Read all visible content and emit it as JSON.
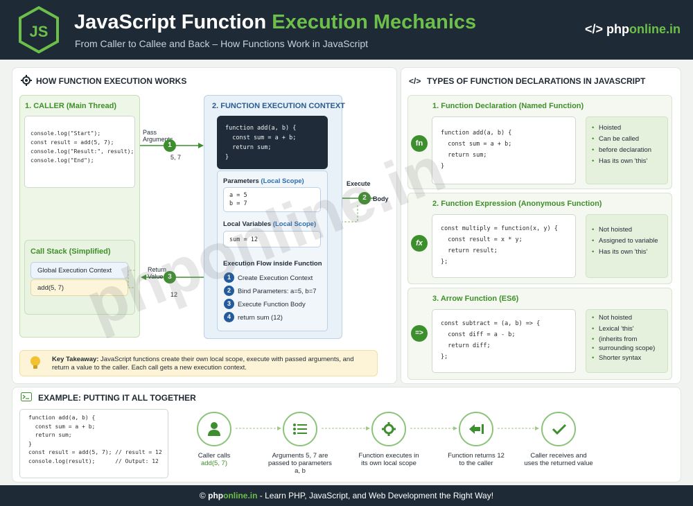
{
  "header": {
    "logo_text": "JS",
    "title_part1": "JavaScript Function ",
    "title_part2": "Execution Mechanics",
    "subtitle": "From Caller to Callee and Back – How Functions Work in JavaScript",
    "brand_prefix": "</> php",
    "brand_suffix": "online.in"
  },
  "left": {
    "title": "HOW FUNCTION EXECUTION WORKS",
    "caller": {
      "title": "1. CALLER (Main Thread)",
      "code": [
        "console.log(\"Start\");",
        "const result = add(5, 7);",
        "console.log(\"Result:\", result);",
        "",
        "console.log(\"End\");"
      ]
    },
    "call_stack": {
      "title": "Call Stack (Simplified)",
      "frame1": "Global Execution Context",
      "frame2": "add(5, 7)"
    },
    "pass_arrow": {
      "label": "Pass Arguments",
      "num": "1",
      "value": "5, 7"
    },
    "exec_arrow": {
      "label": "Execute",
      "num": "2",
      "value": "Body"
    },
    "return_arrow": {
      "label": "Return Value",
      "num": "3",
      "value": "12"
    },
    "context": {
      "title": "2. FUNCTION EXECUTION CONTEXT",
      "code": [
        "function add(a, b) {",
        "  const sum = a + b;",
        "  return sum;",
        "}"
      ],
      "params_title": "Parameters",
      "params_scope": "(Local Scope)",
      "params": [
        "a = 5",
        "b = 7"
      ],
      "locals_title": "Local Variables",
      "locals_scope": "(Local Scope)",
      "locals": [
        "sum = 12"
      ],
      "flow_title": "Execution Flow inside Function",
      "flow": [
        {
          "n": "1",
          "text": "Create Execution Context"
        },
        {
          "n": "2",
          "text": "Bind Parameters: a=5, b=7"
        },
        {
          "n": "3",
          "text": "Execute Function Body"
        },
        {
          "n": "4",
          "text": "return sum (12)"
        }
      ]
    },
    "takeaway_label": "Key Takeaway:",
    "takeaway_text": " JavaScript functions create their own local scope, execute with passed arguments, and return a value to the caller. Each call gets a new execution context."
  },
  "right": {
    "title": "TYPES OF FUNCTION DECLARATIONS IN JAVASCRIPT",
    "types": [
      {
        "title": "1. Function Declaration (Named Function)",
        "icon": "fn",
        "code": [
          "function add(a, b) {",
          "  const sum = a + b;",
          "  return sum;",
          "}"
        ],
        "features": [
          "Hoisted",
          "Can be called",
          "before declaration",
          "Has its own 'this'"
        ]
      },
      {
        "title": "2. Function Expression (Anonymous Function)",
        "icon": "fx",
        "code": [
          "const multiply = function(x, y) {",
          "  const result = x * y;",
          "  return result;",
          "};"
        ],
        "features": [
          "Not hoisted",
          "Assigned to variable",
          "Has its own 'this'"
        ]
      },
      {
        "title": "3. Arrow Function (ES6)",
        "icon": "=>",
        "code": [
          "const subtract = (a, b) => {",
          "  const diff = a - b;",
          "  return diff;",
          "};"
        ],
        "features": [
          "Not hoisted",
          "Lexical 'this'",
          "(inherits from",
          "surrounding scope)",
          "Shorter syntax"
        ]
      }
    ]
  },
  "example": {
    "title": "EXAMPLE: PUTTING IT ALL TOGETHER",
    "code": [
      "function add(a, b) {",
      "  const sum = a + b;",
      "  return sum;",
      "}",
      "",
      "const result = add(5, 7); // result = 12",
      "console.log(result);      // Output: 12"
    ],
    "steps": [
      {
        "icon": "user-icon",
        "line1": "Caller calls",
        "line2": "add(5, 7)",
        "line3": ""
      },
      {
        "icon": "list-icon",
        "line1": "Arguments 5, 7 are",
        "line2": "passed to parameters",
        "line3": "a, b"
      },
      {
        "icon": "gear-icon",
        "line1": "Function executes in",
        "line2": "its own local scope",
        "line3": ""
      },
      {
        "icon": "return-icon",
        "line1": "Function returns 12",
        "line2": "to the caller",
        "line3": ""
      },
      {
        "icon": "check-icon",
        "line1": "Caller receives and",
        "line2": "uses the returned value",
        "line3": ""
      }
    ]
  },
  "footer": {
    "copy": "© ",
    "brand1": "php",
    "brand2": "online.in",
    "rest": " - Learn PHP, JavaScript, and Web Development the Right Way!"
  },
  "watermark": "phponline.in"
}
